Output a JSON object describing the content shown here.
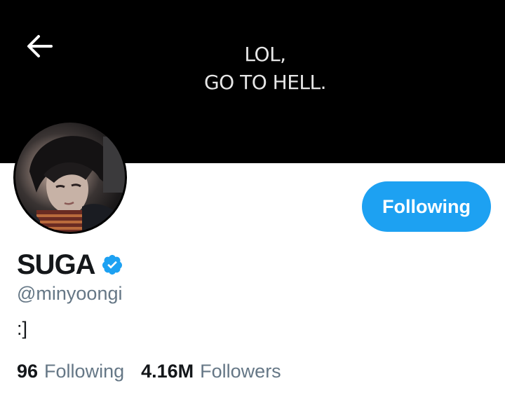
{
  "header": {
    "back_icon": "arrow-left-icon",
    "banner_text_line1": "LOL,",
    "banner_text_line2": "GO TO HELL."
  },
  "profile": {
    "display_name": "SUGA",
    "verified": true,
    "verified_icon": "verified-badge-icon",
    "handle": "@minyoongi",
    "bio": ":]",
    "follow_button_label": "Following"
  },
  "stats": {
    "following_count": "96",
    "following_label": "Following",
    "followers_count": "4.16M",
    "followers_label": "Followers"
  },
  "colors": {
    "accent": "#1da1f2",
    "text_primary": "#14171a",
    "text_secondary": "#657786",
    "banner_bg": "#000000"
  }
}
